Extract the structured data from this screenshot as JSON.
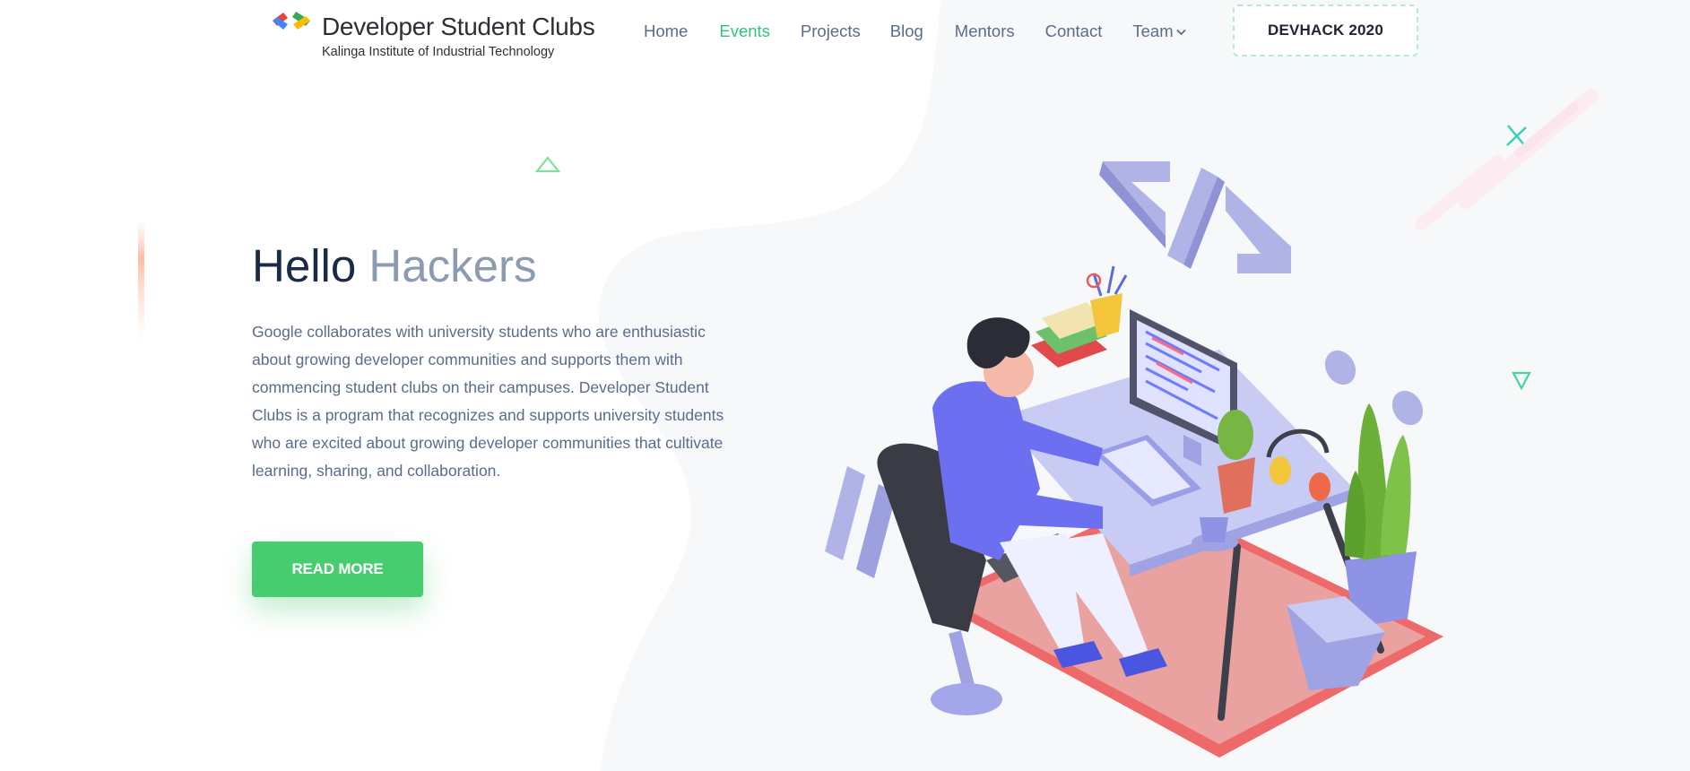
{
  "brand": {
    "title": "Developer Student Clubs",
    "subtitle": "Kalinga Institute of Industrial Technology"
  },
  "nav": {
    "items": [
      {
        "label": "Home",
        "active": false
      },
      {
        "label": "Events",
        "active": true
      },
      {
        "label": "Projects",
        "active": false
      },
      {
        "label": "Blog",
        "active": false
      },
      {
        "label": "Mentors",
        "active": false
      },
      {
        "label": "Contact",
        "active": false
      },
      {
        "label": "Team",
        "active": false,
        "dropdown": true
      }
    ],
    "cta": "DEVHACK 2020"
  },
  "hero": {
    "title_main": "Hello",
    "title_accent": "Hackers",
    "description": "Google collaborates with university students who are enthusiastic about growing developer communities and supports them with commencing student clubs on their campuses. Developer Student Clubs is a program that recognizes and supports university students who are excited about growing developer communities that cultivate learning, sharing, and collaboration.",
    "button": "READ MORE"
  },
  "icons": {
    "logo": "dsc-chevrons-logo",
    "dropdown": "chevron-down-icon",
    "illustration": "developer-at-desk-illustration"
  },
  "colors": {
    "accent_green": "#2ec47a",
    "button_green": "#47cd70",
    "heading": "#1b2a47",
    "heading_accent": "#8c9bb0",
    "body_text": "#5b6b8c",
    "illustration_purple": "#7b7fe6",
    "rug_red": "#ee6a6a"
  }
}
